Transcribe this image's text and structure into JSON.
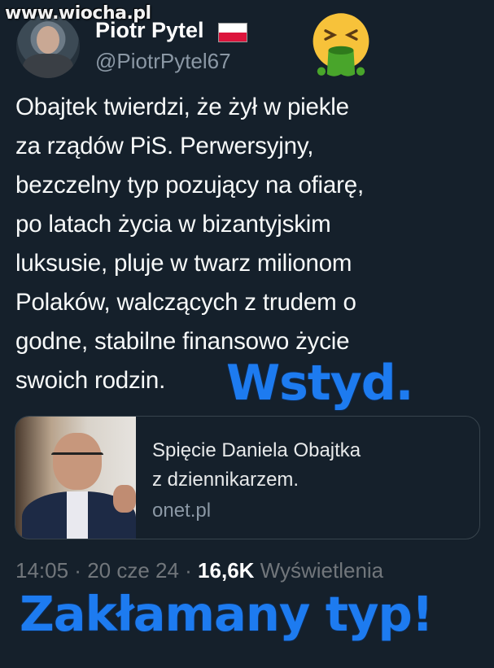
{
  "watermark": "www.wiocha.pl",
  "author": {
    "name": "Piotr Pytel",
    "handle": "@PiotrPytel67",
    "flag_colors": [
      "#ffffff",
      "#dc143c"
    ]
  },
  "emoji": "nauseated-vomit-emoji",
  "tweet": {
    "text": "Obajtek twierdzi, że żył w piekle\nza rządów PiS. Perwersyjny,\nbezczelny typ pozujący na ofiarę,\npo latach życia w bizantyjskim\nluksusie, pluje w twarz milionom\nPolaków, walczących z trudem o\ngodne, stabilne finansowo życie\nswoich rodzin."
  },
  "overlays": {
    "first": "Wstyd.",
    "second": "Zakłamany typ!",
    "color": "#1d7bf0"
  },
  "link_card": {
    "title": "Spięcie Daniela Obajtka\nz dziennikarzem.",
    "domain": "onet.pl"
  },
  "meta": {
    "time": "14:05",
    "sep1": " · ",
    "date": "20 cze 24",
    "sep2": " · ",
    "views_count": "16,6K",
    "views_label": " Wyświetlenia"
  },
  "colors": {
    "background": "#15202b",
    "text": "#e7e9ea",
    "secondary": "#8b98a5"
  }
}
